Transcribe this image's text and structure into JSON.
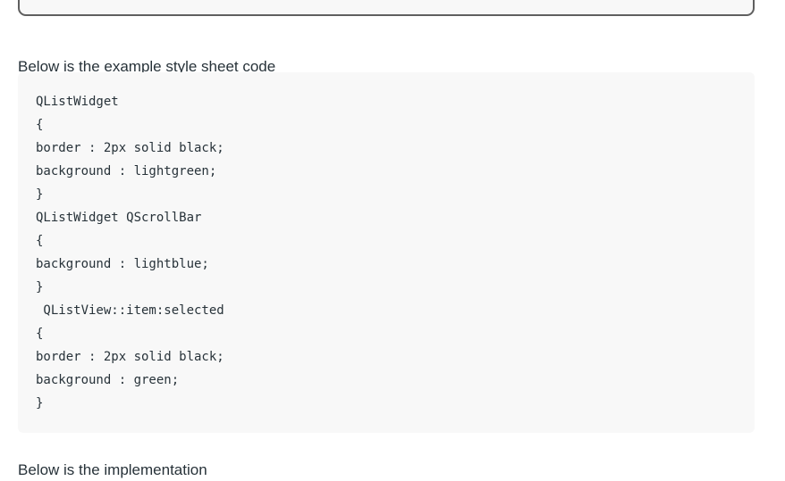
{
  "intro_text": "Below is the example style sheet code",
  "code": {
    "lines": [
      "QListWidget",
      "{",
      "border : 2px solid black;",
      "background : lightgreen;",
      "}",
      "QListWidget QScrollBar",
      "{",
      "background : lightblue;",
      "}",
      " QListView::item:selected",
      "{",
      "border : 2px solid black;",
      "background : green;",
      "}"
    ]
  },
  "outro_text": "Below is the implementation"
}
